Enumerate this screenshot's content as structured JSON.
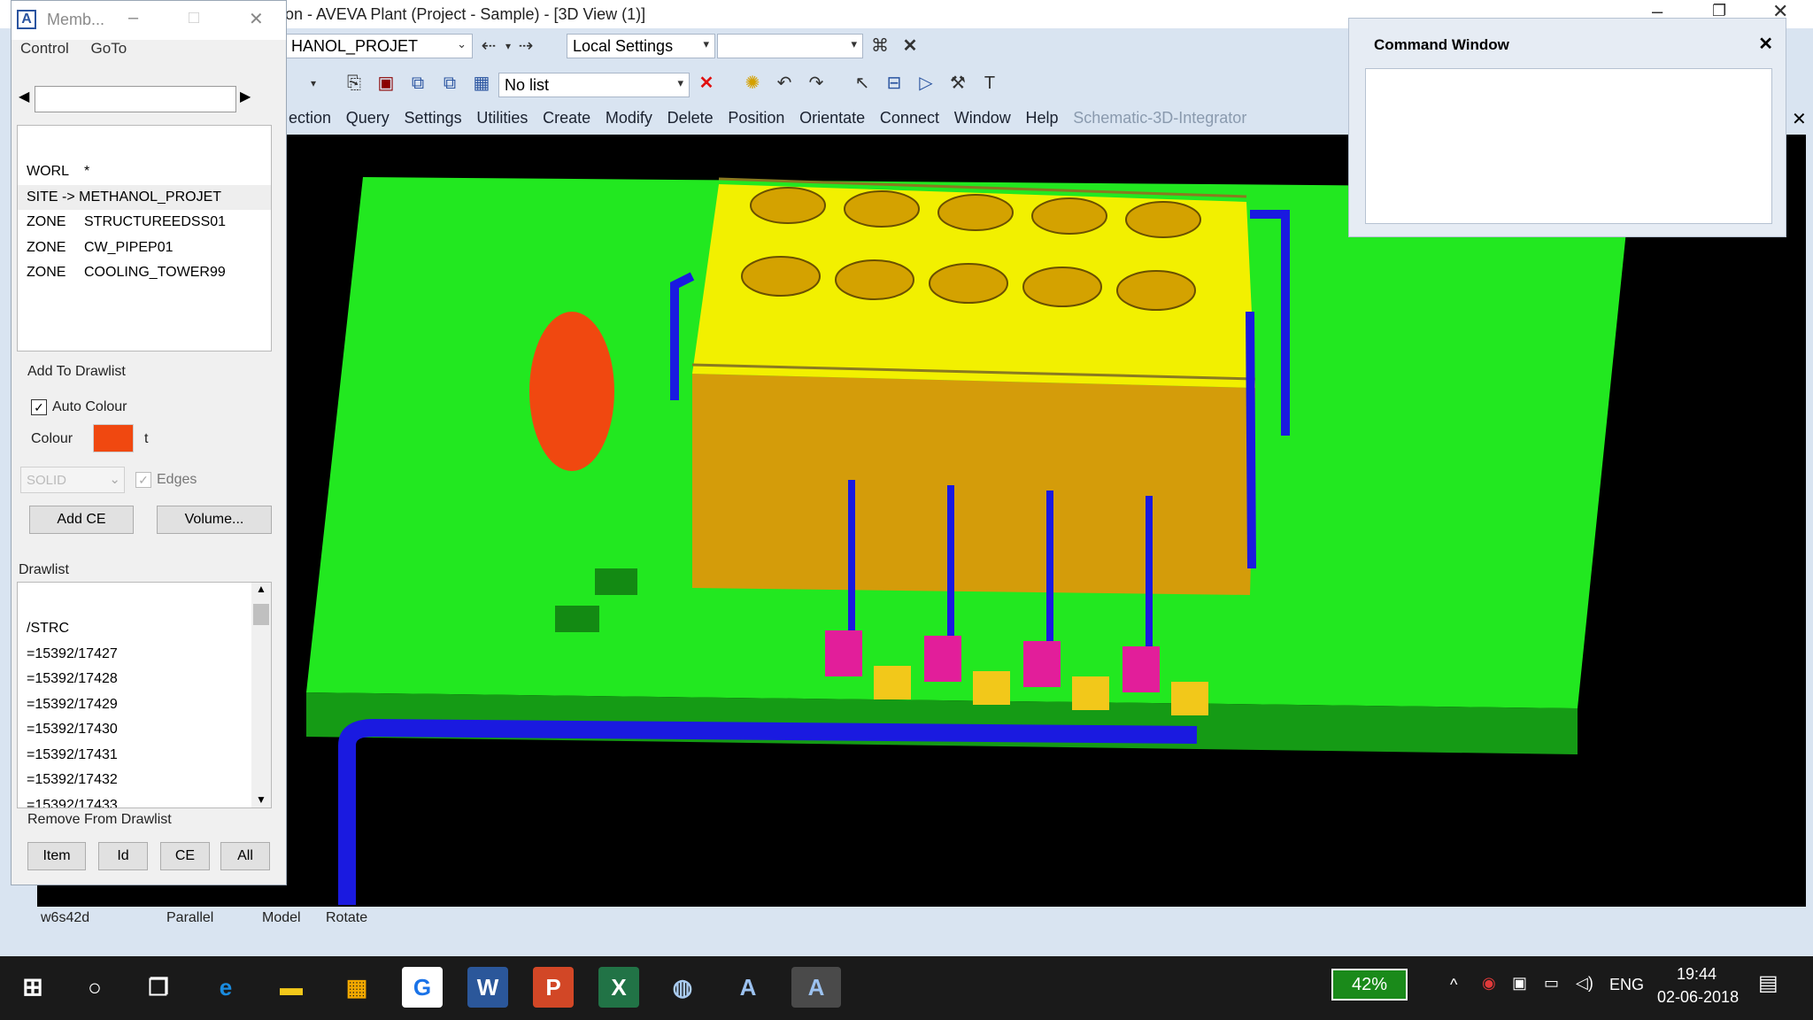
{
  "app": {
    "title": "on -  AVEVA Plant (Project - Sample) - [3D View (1)]"
  },
  "toolbar": {
    "project_value": "HANOL_PROJET",
    "settings_value": "Local Settings",
    "list_value": "No list"
  },
  "menubar": [
    "ection",
    "Query",
    "Settings",
    "Utilities",
    "Create",
    "Modify",
    "Delete",
    "Position",
    "Orientate",
    "Connect",
    "Window",
    "Help",
    "Schematic-3D-Integrator"
  ],
  "members": {
    "title": "Memb...",
    "menu": [
      "Control",
      "GoTo"
    ],
    "hierarchy": [
      {
        "k": "WORL",
        "v": "*"
      },
      {
        "k": "SITE -> METHANOL_PROJET",
        "v": ""
      },
      {
        "k": "ZONE",
        "v": "STRUCTUREEDSS01"
      },
      {
        "k": "ZONE",
        "v": "CW_PIPEP01"
      },
      {
        "k": "ZONE",
        "v": "COOLING_TOWER99"
      }
    ],
    "add_to_drawlist": "Add To Drawlist",
    "auto_colour": "Auto Colour",
    "colour_label": "Colour",
    "colour_value": "#f04810",
    "colour_suffix": "t",
    "solid": "SOLID",
    "edges": "Edges",
    "add_ce": "Add CE",
    "volume": "Volume...",
    "drawlist_label": "Drawlist",
    "drawlist": [
      "/STRC",
      "=15392/17427",
      "=15392/17428",
      "=15392/17429",
      "=15392/17430",
      "=15392/17431",
      "=15392/17432",
      "=15392/17433"
    ],
    "remove_from_drawlist": "Remove From Drawlist",
    "remove_buttons": [
      "Item",
      "Id",
      "CE",
      "All"
    ]
  },
  "command_window": {
    "title": "Command Window"
  },
  "status": {
    "a": "w6s42d",
    "b": "Parallel",
    "c": "Model",
    "d": "Rotate"
  },
  "taskbar": {
    "battery": "42%",
    "lang": "ENG",
    "time": "19:44",
    "date": "02-06-2018"
  },
  "colors": {
    "ground": "#22e820",
    "tower": "#f2f000",
    "pipe": "#1a1ae0",
    "pump": "#e21e9a",
    "vessel": "#f04810"
  }
}
